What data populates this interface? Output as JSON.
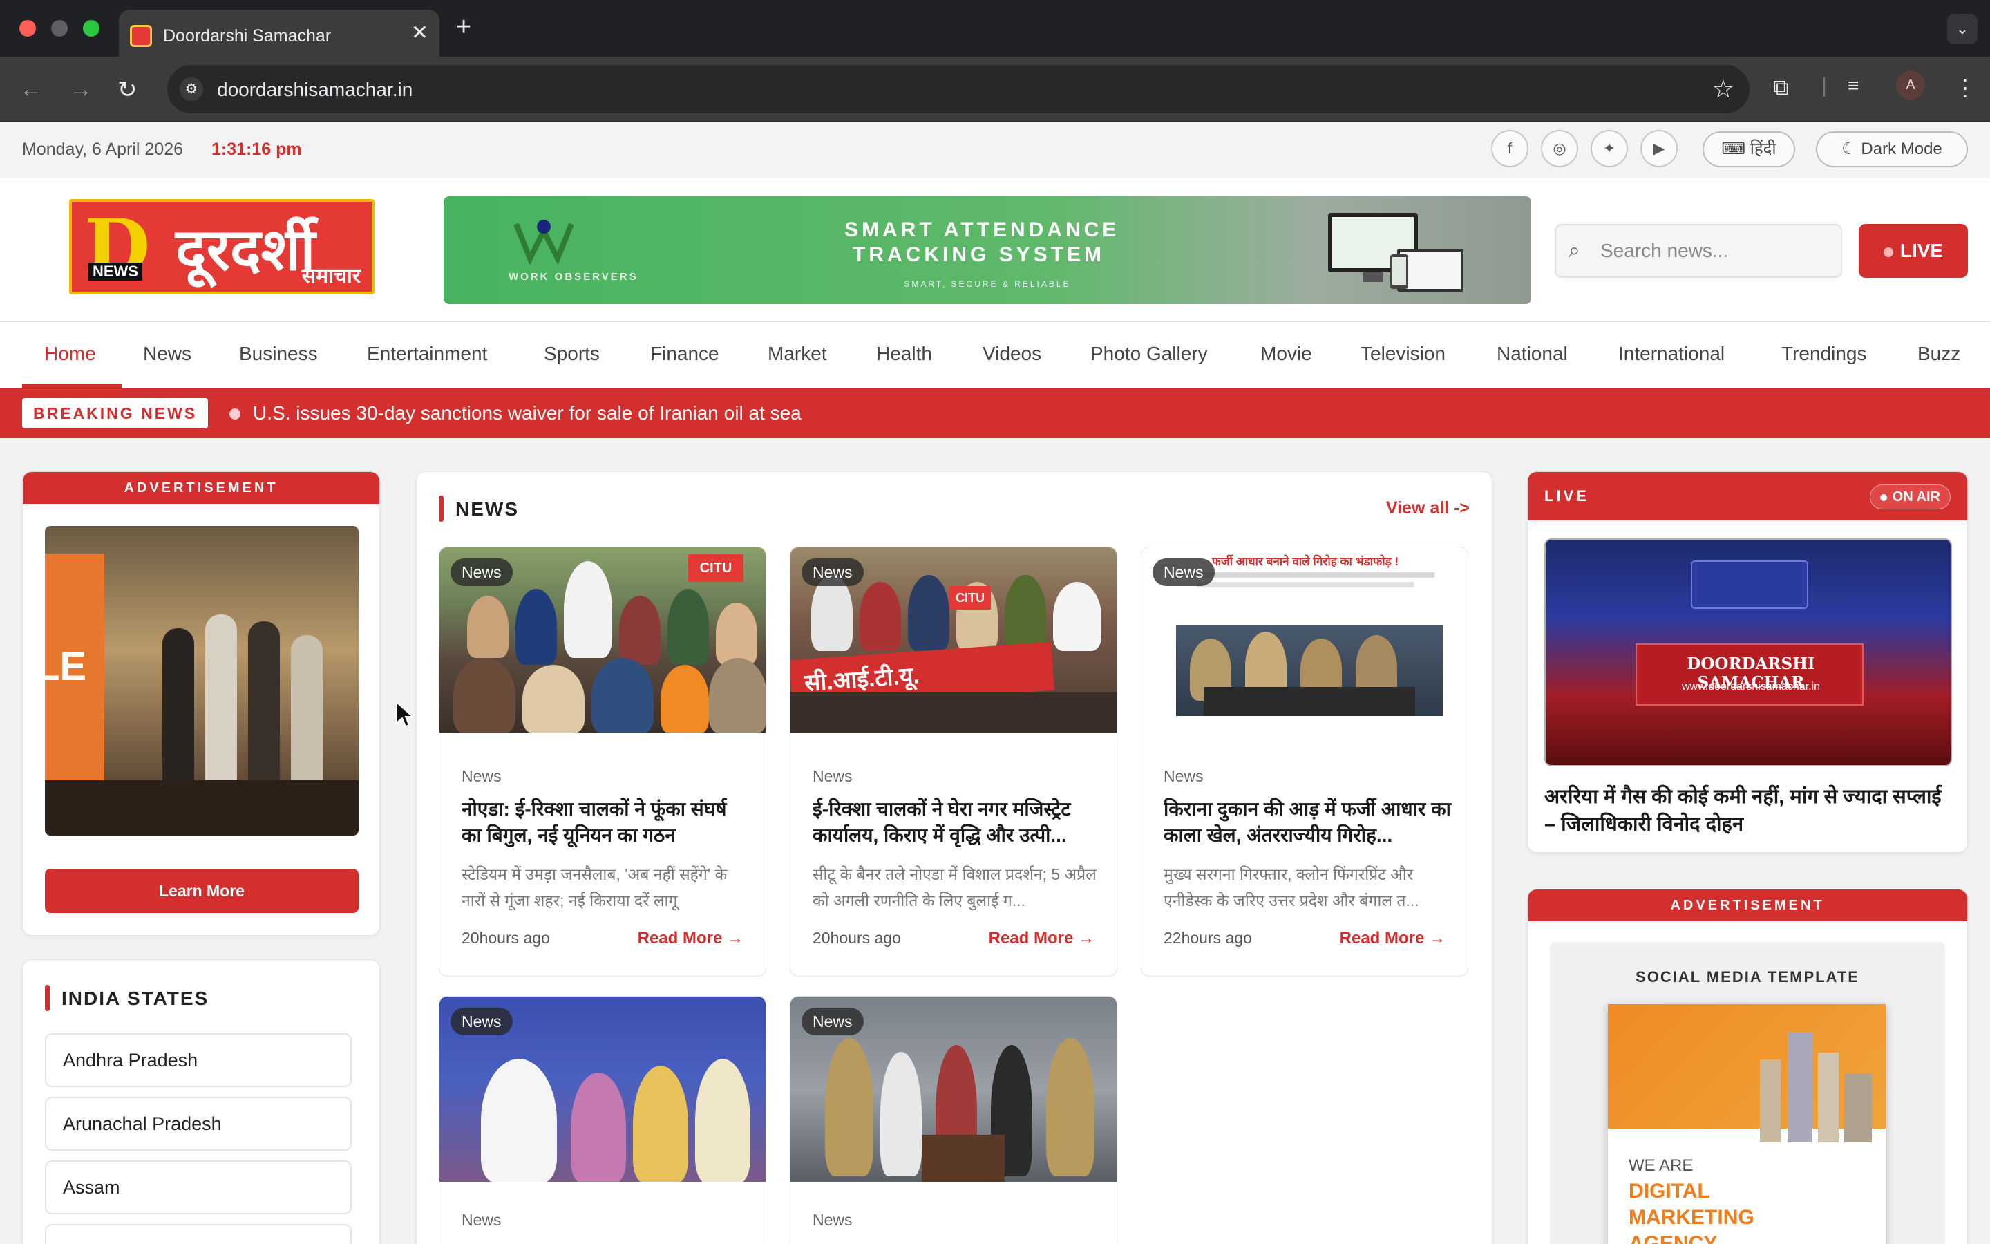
{
  "browser": {
    "tab_title": "Doordarshi Samachar",
    "url": "doordarshisamachar.in",
    "avatar_letter": "A"
  },
  "topbar": {
    "date": "Monday, 6 April 2026",
    "time": "1:31:16 pm",
    "social": [
      "facebook-icon",
      "instagram-icon",
      "twitter-icon",
      "youtube-icon"
    ],
    "language_label": "हिंदी",
    "dark_mode_label": "Dark Mode"
  },
  "header": {
    "logo_news": "NEWS",
    "logo_title": "दूरदर्शी",
    "logo_subtitle": "समाचार",
    "banner": {
      "brand": "WORK OBSERVERS",
      "headline_1": "SMART ATTENDANCE",
      "headline_2": "TRACKING SYSTEM",
      "tagline": "SMART, SECURE & RELIABLE"
    },
    "search_placeholder": "Search news...",
    "live_label": "LIVE"
  },
  "nav": {
    "items": [
      "Home",
      "News",
      "Business",
      "Entertainment",
      "Sports",
      "Finance",
      "Market",
      "Health",
      "Videos",
      "Photo Gallery",
      "Movie",
      "Television",
      "National",
      "International",
      "Trendings",
      "Buzz"
    ],
    "active": "Home"
  },
  "breaking": {
    "label": "BREAKING NEWS",
    "text": "U.S. issues 30-day sanctions waiver for sale of Iranian oil at sea"
  },
  "left": {
    "ad_label": "ADVERTISEMENT",
    "ad_image_text": "LE",
    "learn_more": "Learn More",
    "states_title": "INDIA STATES",
    "states": [
      "Andhra Pradesh",
      "Arunachal Pradesh",
      "Assam"
    ]
  },
  "center": {
    "section_title": "NEWS",
    "view_all": "View all ->",
    "read_more": "Read More →",
    "articles": [
      {
        "badge": "News",
        "category": "News",
        "title": "नोएडा: ई-रिक्शा चालकों ने फूंका संघर्ष का बिगुल, नई यूनियन का गठन",
        "excerpt": "स्टेडियम में उमड़ा जनसैलाब, 'अब नहीं सहेंगे' के नारों से गूंजा शहर; नई किराया दरें लागू",
        "time": "20hours ago"
      },
      {
        "badge": "News",
        "category": "News",
        "title": "ई-रिक्शा चालकों ने घेरा नगर मजिस्ट्रेट कार्यालय, किराए में वृद्धि और उत्पी...",
        "excerpt": "सीटू के बैनर तले नोएडा में विशाल प्रदर्शन; 5 अप्रैल को अगली रणनीति के लिए बुलाई ग...",
        "time": "20hours ago"
      },
      {
        "badge": "News",
        "category": "News",
        "title": "किराना दुकान की आड़ में फर्जी आधार का काला खेल, अंतरराज्यीय गिरोह...",
        "excerpt": "मुख्य सरगना गिरफ्तार, क्लोन फिंगरप्रिंट और एनीडेस्क के जरिए उत्तर प्रदेश और बंगाल त...",
        "time": "22hours ago",
        "image_caption": "फर्जी आधार बनाने वाले गिरोह का भंडाफोड़ !"
      },
      {
        "badge": "News",
        "category": "News"
      },
      {
        "badge": "News",
        "category": "News"
      }
    ],
    "photo_banner_1": "CITU",
    "photo_banner_2": "सी.आई.टी.यू."
  },
  "right": {
    "live_label": "LIVE",
    "on_air": "ON AIR",
    "video_title": "DOORDARSHI SAMACHAR",
    "video_url": "www.doordarshisamachar.in",
    "live_headline": "अररिया में गैस की कोई कमी नहीं, मांग से ज्यादा सप्लाई – जिलाधिकारी विनोद दोहन",
    "ad_label": "ADVERTISEMENT",
    "ad_title": "SOCIAL MEDIA TEMPLATE",
    "ad_we_are": "WE ARE",
    "ad_big": [
      "DIGITAL",
      "MARKETING",
      "AGENCY"
    ]
  },
  "colors": {
    "brand_red": "#d32f2f",
    "logo_yellow": "#f5b800",
    "banner_green": "#47b35e"
  }
}
